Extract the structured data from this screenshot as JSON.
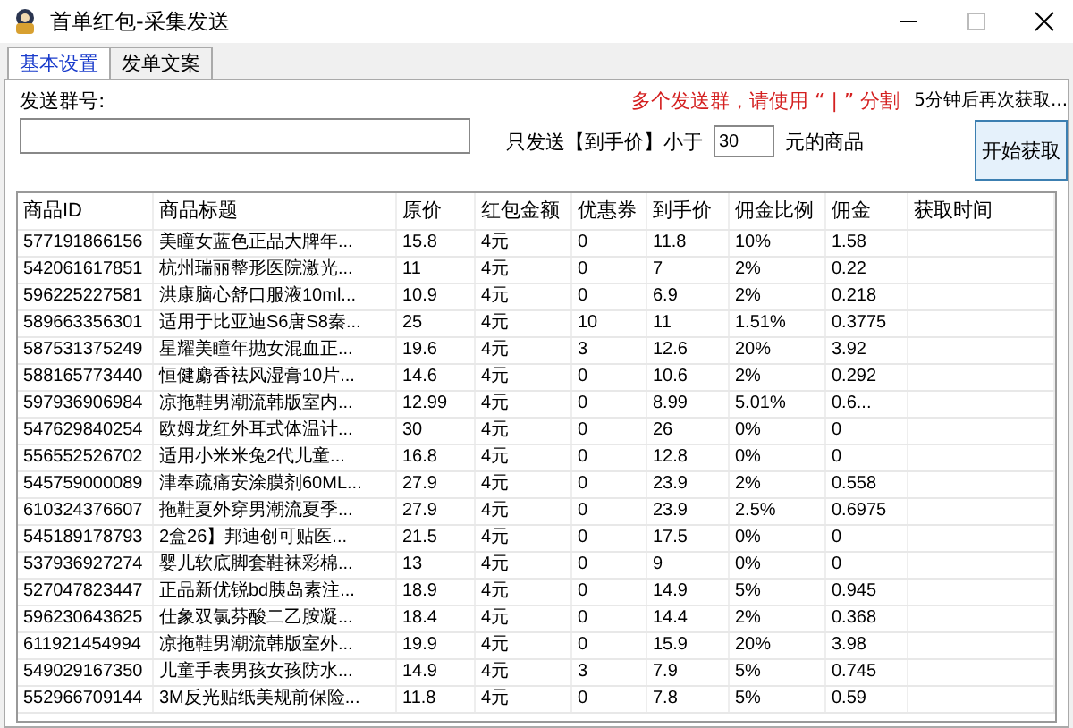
{
  "window": {
    "title": "首单红包-采集发送"
  },
  "tabs": [
    {
      "label": "基本设置",
      "selected": true
    },
    {
      "label": "发单文案",
      "selected": false
    }
  ],
  "group_field": {
    "label": "发送群号:"
  },
  "hint": "多个发送群，请使用 “ | ” 分割",
  "countdown": "5分钟后再次获取...",
  "price_filter": {
    "prefix": "只发送【到手价】小于",
    "value": "30",
    "suffix": "元的商品"
  },
  "start_button": "开始获取",
  "table": {
    "columns": [
      "商品ID",
      "商品标题",
      "原价",
      "红包金额",
      "优惠券",
      "到手价",
      "佣金比例",
      "佣金",
      "获取时间"
    ],
    "rows": [
      [
        "577191866156",
        "美瞳女蓝色正品大牌年...",
        "15.8",
        "4元",
        "0",
        "11.8",
        "10%",
        "1.58",
        ""
      ],
      [
        "542061617851",
        "杭州瑞丽整形医院激光...",
        "11",
        "4元",
        "0",
        "7",
        "2%",
        "0.22",
        ""
      ],
      [
        "596225227581",
        "洪康脑心舒口服液10ml...",
        "10.9",
        "4元",
        "0",
        "6.9",
        "2%",
        "0.218",
        ""
      ],
      [
        "589663356301",
        "适用于比亚迪S6唐S8秦...",
        "25",
        "4元",
        "10",
        "11",
        "1.51%",
        "0.3775",
        ""
      ],
      [
        "587531375249",
        "星耀美瞳年抛女混血正...",
        "19.6",
        "4元",
        "3",
        "12.6",
        "20%",
        "3.92",
        ""
      ],
      [
        "588165773440",
        "恒健麝香祛风湿膏10片...",
        "14.6",
        "4元",
        "0",
        "10.6",
        "2%",
        "0.292",
        ""
      ],
      [
        "597936906984",
        "凉拖鞋男潮流韩版室内...",
        "12.99",
        "4元",
        "0",
        "8.99",
        "5.01%",
        "0.6...",
        ""
      ],
      [
        "547629840254",
        "欧姆龙红外耳式体温计...",
        "30",
        "4元",
        "0",
        "26",
        "0%",
        "0",
        ""
      ],
      [
        "556552526702",
        "适用小米米兔2代儿童...",
        "16.8",
        "4元",
        "0",
        "12.8",
        "0%",
        "0",
        ""
      ],
      [
        "545759000089",
        "津奉疏痛安涂膜剂60ML...",
        "27.9",
        "4元",
        "0",
        "23.9",
        "2%",
        "0.558",
        ""
      ],
      [
        "610324376607",
        "拖鞋夏外穿男潮流夏季...",
        "27.9",
        "4元",
        "0",
        "23.9",
        "2.5%",
        "0.6975",
        ""
      ],
      [
        "545189178793",
        "2盒26】邦迪创可贴医...",
        "21.5",
        "4元",
        "0",
        "17.5",
        "0%",
        "0",
        ""
      ],
      [
        "537936927274",
        "婴儿软底脚套鞋袜彩棉...",
        "13",
        "4元",
        "0",
        "9",
        "0%",
        "0",
        ""
      ],
      [
        "527047823447",
        "正品新优锐bd胰岛素注...",
        "18.9",
        "4元",
        "0",
        "14.9",
        "5%",
        "0.945",
        ""
      ],
      [
        "596230643625",
        "仕象双氯芬酸二乙胺凝...",
        "18.4",
        "4元",
        "0",
        "14.4",
        "2%",
        "0.368",
        ""
      ],
      [
        "611921454994",
        "凉拖鞋男潮流韩版室外...",
        "19.9",
        "4元",
        "0",
        "15.9",
        "20%",
        "3.98",
        ""
      ],
      [
        "549029167350",
        "儿童手表男孩女孩防水...",
        "14.9",
        "4元",
        "3",
        "7.9",
        "5%",
        "0.745",
        ""
      ],
      [
        "552966709144",
        "3M反光贴纸美规前保险...",
        "11.8",
        "4元",
        "0",
        "7.8",
        "5%",
        "0.59",
        ""
      ]
    ]
  }
}
